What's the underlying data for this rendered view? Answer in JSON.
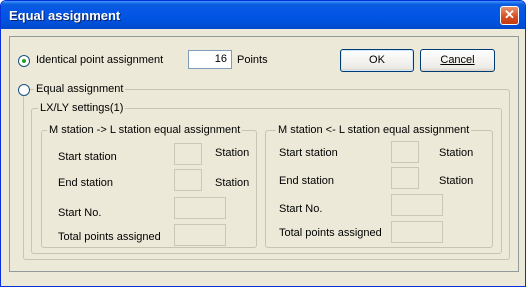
{
  "window": {
    "title": "Equal assignment",
    "close_glyph": "✕"
  },
  "identical": {
    "label": "Identical point assignment",
    "value": "16",
    "unit": "Points",
    "selected": true
  },
  "buttons": {
    "ok": "OK",
    "cancel": "Cancel"
  },
  "equal": {
    "label": "Equal assignment",
    "selected": false
  },
  "lxly": {
    "title": "LX/LY settings(1)"
  },
  "m_to_l": {
    "title": "M station -> L station equal assignment",
    "start_station": "Start station",
    "end_station": "End station",
    "station_unit": "Station",
    "start_no": "Start No.",
    "total_points": "Total points assigned"
  },
  "l_to_m": {
    "title": "M station <- L station equal assignment",
    "start_station": "Start station",
    "end_station": "End station",
    "station_unit": "Station",
    "start_no": "Start No.",
    "total_points": "Total points assigned"
  }
}
